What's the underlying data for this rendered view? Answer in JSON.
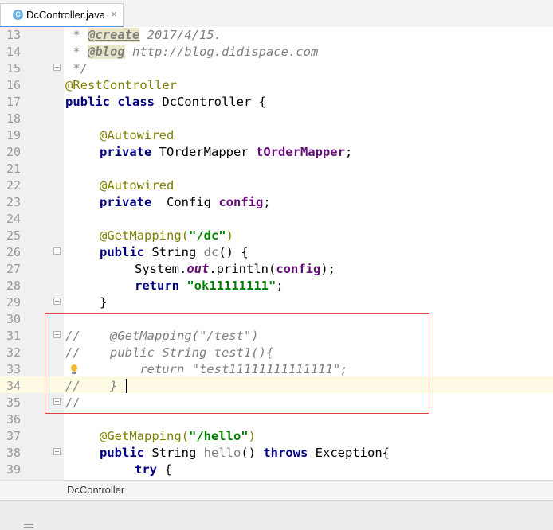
{
  "tab": {
    "filename": "DcController.java",
    "icon": "java-class-icon"
  },
  "breadcrumb": {
    "label": "DcController"
  },
  "line_numbers": [
    "13",
    "14",
    "15",
    "16",
    "17",
    "18",
    "19",
    "20",
    "21",
    "22",
    "23",
    "24",
    "25",
    "26",
    "27",
    "28",
    "29",
    "30",
    "31",
    "32",
    "33",
    "34",
    "35",
    "36",
    "37",
    "38",
    "39"
  ],
  "code": {
    "l13": {
      "star": " * ",
      "tag": "@create",
      "text": " 2017/4/15."
    },
    "l14": {
      "star": " * ",
      "tag": "@blog",
      "text": " http://blog.didispace.com"
    },
    "l15": " */",
    "l16": "@RestController",
    "l17": {
      "kw": "public class",
      "rest": " DcController {"
    },
    "l19": "@Autowired",
    "l20": {
      "kw": "private",
      "type": " TOrderMapper ",
      "field": "tOrderMapper",
      "end": ";"
    },
    "l22": "@Autowired",
    "l23": {
      "kw": "private",
      "type": "  Config ",
      "field": "config",
      "end": ";"
    },
    "l25": {
      "ann": "@GetMapping(",
      "str": "\"/dc\"",
      "end": ")"
    },
    "l26": {
      "kw": "public",
      "type": " String ",
      "name": "dc",
      "end": "() {"
    },
    "l27": {
      "pre": "System.",
      "staticf": "out",
      "mid": ".println(",
      "field": "config",
      "end": ");"
    },
    "l28": {
      "kw": "return",
      "str": " \"ok11111111\"",
      "end": ";"
    },
    "l29": "}",
    "l31": "//    @GetMapping(\"/test\")",
    "l32": "//    public String test1(){",
    "l33": "          return \"test11111111111111\";",
    "l34": "//    }",
    "l35": "//",
    "l37": {
      "ann": "@GetMapping(",
      "str": "\"/hello\"",
      "end": ")"
    },
    "l38": {
      "kw": "public",
      "type": " String ",
      "name": "hello",
      "mid": "() ",
      "kw2": "throws",
      "end": " Exception{"
    },
    "l39": {
      "kw": "try",
      "end": " {"
    }
  },
  "colors": {
    "keyword": "#000080",
    "annotation": "#808000",
    "comment": "#808080",
    "string": "#008000",
    "field": "#660e7a",
    "highlight_box": "#e04040",
    "current_line": "#fffae3"
  }
}
